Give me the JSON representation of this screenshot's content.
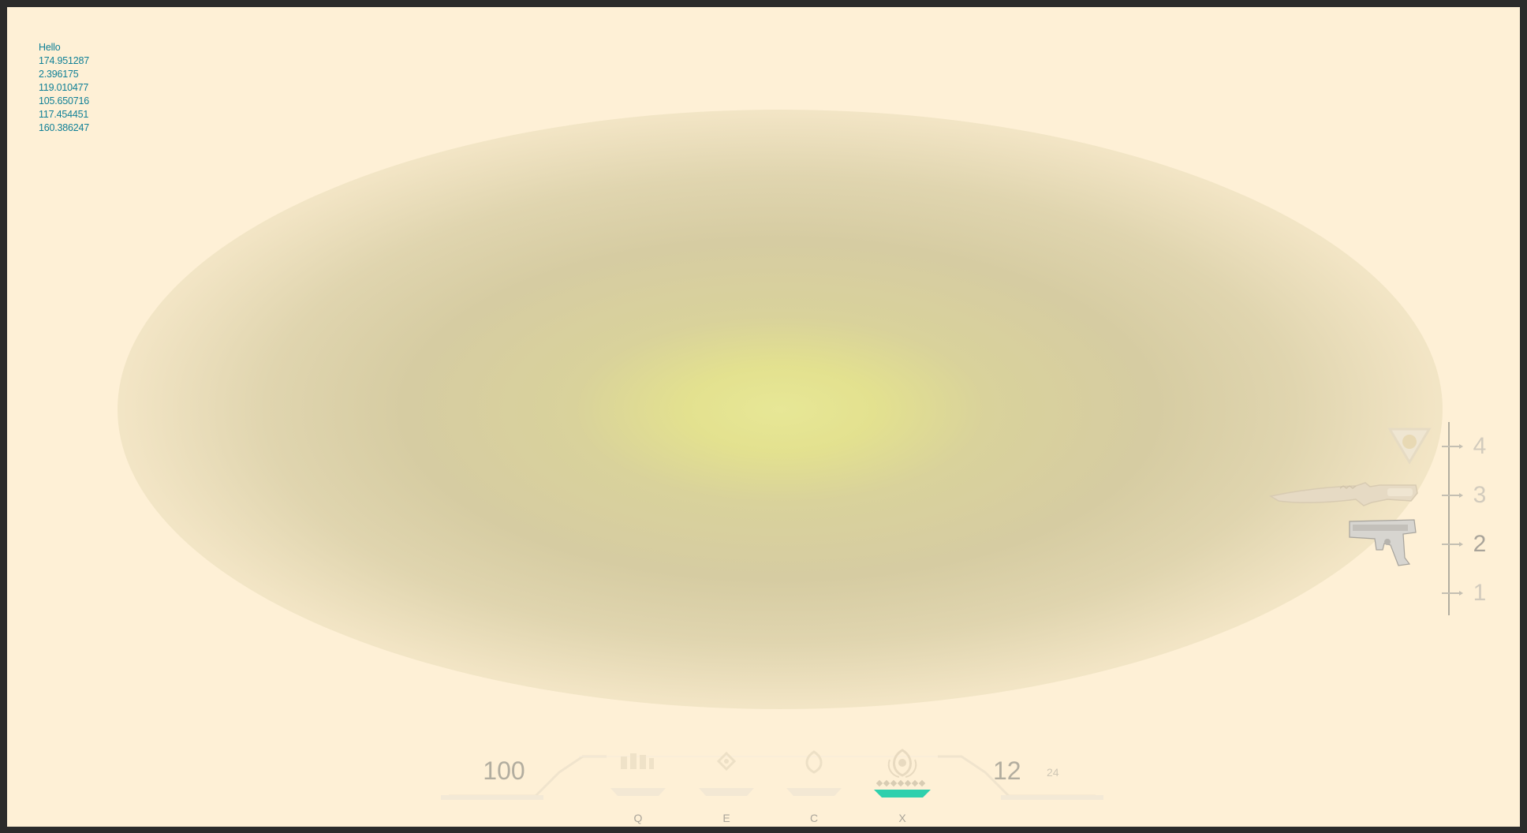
{
  "debug": {
    "lines": [
      "Hello",
      "174.951287",
      "2.396175",
      "119.010477",
      "105.650716",
      "117.454451",
      "160.386247"
    ]
  },
  "inventory": {
    "slots": [
      "4",
      "3",
      "2",
      "1"
    ],
    "active_slot": "2",
    "weapons": [
      "spike-icon",
      "knife-icon",
      "pistol-icon"
    ]
  },
  "hud": {
    "health": "100",
    "ammo": "12",
    "ammo_reserve": "24",
    "abilities": [
      {
        "key": "Q",
        "icon": "ability-q-icon"
      },
      {
        "key": "E",
        "icon": "ability-e-icon"
      },
      {
        "key": "C",
        "icon": "ability-c-icon"
      },
      {
        "key": "X",
        "icon": "ultimate-icon",
        "ready_color": "#2ed0ad"
      }
    ]
  },
  "colors": {
    "background": "#fef0d6",
    "haze_center": "#e7e796",
    "debug_text": "#0e7f96",
    "ultimate_accent": "#2ed0ad"
  }
}
